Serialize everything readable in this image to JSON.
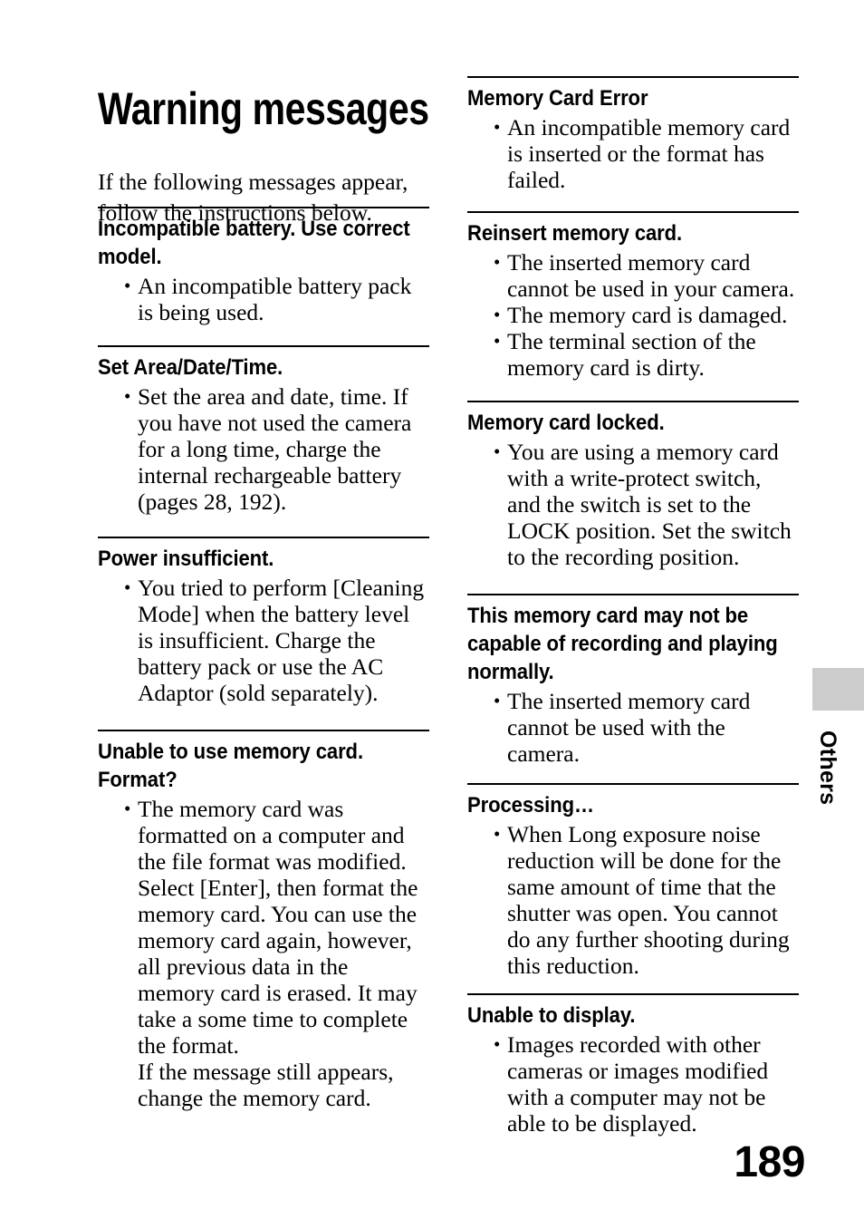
{
  "document": {
    "title": "Warning messages",
    "intro": "If the following messages appear, follow the instructions below.",
    "page_number": "189",
    "side_tab_label": "Others",
    "side_tab_color": "#cccccc"
  },
  "left_column": {
    "sections": [
      {
        "heading": "Incompatible battery. Use correct model.",
        "bullets": [
          [
            "An incompatible battery pack is being used."
          ]
        ]
      },
      {
        "heading": "Set Area/Date/Time.",
        "bullets": [
          [
            "Set the area and date, time. If you have not used the camera for a long time, charge the internal rechargeable battery (pages 28, 192)."
          ]
        ]
      },
      {
        "heading": "Power insufficient.",
        "bullets": [
          [
            "You tried to perform [Cleaning Mode] when the battery level is insufficient. Charge the battery pack or use the AC Adaptor (sold separately)."
          ]
        ]
      },
      {
        "heading": "Unable to use memory card. Format?",
        "bullets": [
          [
            "The memory card was formatted on a computer and the file format was modified.",
            "Select [Enter], then format the memory card. You can use the memory card again, however, all previous data in the memory card is erased. It may take a some time to complete the format.",
            "If the message still appears, change the memory card."
          ]
        ]
      }
    ]
  },
  "right_column": {
    "sections": [
      {
        "heading": "Memory Card Error",
        "bullets": [
          [
            "An incompatible memory card is inserted or the format has failed."
          ]
        ]
      },
      {
        "heading": "Reinsert memory card.",
        "bullets": [
          [
            "The inserted memory card cannot be used in your camera."
          ],
          [
            "The memory card is damaged."
          ],
          [
            "The terminal section of the memory card is dirty."
          ]
        ]
      },
      {
        "heading": "Memory card locked.",
        "bullets": [
          [
            "You are using a memory card with a write-protect switch, and the switch is set to the LOCK position. Set the switch to the recording position."
          ]
        ]
      },
      {
        "heading": "This memory card may not be capable of recording and playing normally.",
        "bullets": [
          [
            "The inserted memory card cannot be used with the camera."
          ]
        ]
      },
      {
        "heading": "Processing…",
        "bullets": [
          [
            "When Long exposure noise reduction will be done for the same amount of time that the shutter was open. You cannot do any further shooting during this reduction."
          ]
        ]
      },
      {
        "heading": "Unable to display.",
        "bullets": [
          [
            "Images recorded with other cameras or images modified with a computer may not be able to be displayed."
          ]
        ]
      }
    ]
  }
}
